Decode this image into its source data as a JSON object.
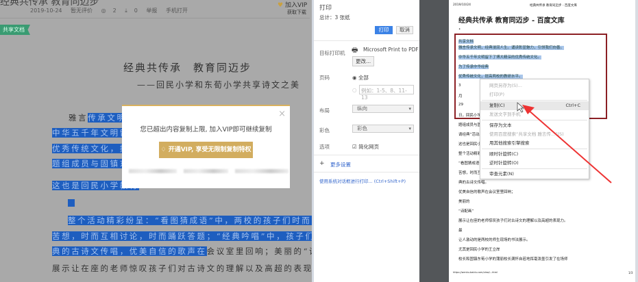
{
  "left_page": {
    "doc_title": "经典共传承 教育同迈步",
    "meta": {
      "date": "2019-10-24",
      "rating": "暂无评价",
      "views": "2",
      "downloads": "0",
      "report": "举报",
      "mobile": "手机打开"
    },
    "join_vip": "加入VIP",
    "join_vip_sub": "获取下载",
    "shared_tag": "共享文档",
    "title": "经典共传承　教育同迈步",
    "subtitle": "——回民小学和东荀小学共享诗文之美",
    "lines": [
      {
        "plain": "雅言",
        "hl": "传承文明，"
      },
      {
        "plain": "",
        "hl": "中华五千年文明留下"
      },
      {
        "plain": "",
        "hl": "优秀传统文化，提高"
      },
      {
        "plain": "",
        "hl": "题组成员与固镇东荀"
      },
      {
        "plain": "",
        "hl": "这也是回民小学教育"
      },
      {
        "plain": "",
        "hl": "整个活动精彩纷呈：“看图猜成语”中，两校的孩子们时而冥思"
      },
      {
        "plain": "",
        "hl": "苦想，时而互相讨论，时而踊跃答题；“经典吟唱”中，孩子们把经"
      },
      {
        "plain": "会议室里回响；美丽的“诗配画”",
        "hl": "典的古诗文传唱，优美自信的歌声在"
      },
      {
        "plain": "展示让在座的老师惊叹孩子们对古诗文的理解以及高超的表现力。最",
        "hl": ""
      }
    ],
    "modal": {
      "message": "您已超出内容复制上限, 加入VIP即可继续复制",
      "button": "开通VIP, 享受无限制复制特权",
      "close": "×"
    }
  },
  "print": {
    "title": "打印",
    "total": "总计：3 张纸",
    "print_btn": "打印",
    "cancel_btn": "取消",
    "printer_label": "目标打印机",
    "printer": "Microsoft Print to PDF",
    "change_btn": "更改...",
    "pages_label": "页码",
    "pages_all": "全部",
    "pages_placeholder": "例如：1-5、8、11-13",
    "layout_label": "布局",
    "layout_value": "纵向",
    "color_label": "彩色",
    "color_value": "彩色",
    "options_label": "选项",
    "simplify": "简化网页",
    "more": "更多设置",
    "system_dialog": "使用系统对话框进行打印... (Ctrl+Shift+P)"
  },
  "preview": {
    "header_date": "2019/10/24",
    "header_title": "经典共传承 教育同迈步 - 百度文库",
    "title": "经典共传承 教育同迈步 - 百度文库",
    "lines_hl": [
      "共享文档",
      "雅言传承文明，经典浸润人生。诵读彰显魅力，引领我们向善。",
      "中华五千年文明留下了博大精深的优秀传统文化。",
      "为了传承中华经典",
      "优秀传统文化，提高两校的教研水平。"
    ],
    "lines": [
      "3",
      "月",
      "29",
      "日，回民小学",
      "题组成员与固",
      "请经典”活动。",
      "这也是回民小学",
      "整个活动精彩",
      "“看图猜成语”",
      "苦想，时而互相",
      "典的古诗文传唱。",
      "优美自信的歌声在会议室里回响；",
      "美丽的",
      "“诗配画”",
      "展示让在座的老师惊叹孩子们对古诗文的理解以及高超的表现力。",
      "最",
      "让人激动的是两校的师生现场的书法展示。",
      "尤其是回民小学的王立岸",
      "校长和固镇东荀小学的蒲丽校长满怀自若地挥毫泼墨引发了在场师"
    ],
    "footer_url": "https://wenku.baidu.com/view/...html",
    "footer_page": "1/3"
  },
  "context_menu": [
    {
      "label": "网页另存为(S)...",
      "disabled": true
    },
    {
      "label": "打印(P)",
      "disabled": true
    },
    {
      "label": "复制(C)",
      "shortcut": "Ctrl+C",
      "hover": true
    },
    {
      "label": "发送文字到手机",
      "disabled": true
    },
    {
      "label": "保存为文本"
    },
    {
      "label": "使用百度搜索“共享文档 雅言传...”(S)",
      "disabled": true
    },
    {
      "label": "用其他搜索引擎搜索"
    },
    {
      "label": "顺时针旋转(C)"
    },
    {
      "label": "逆时针旋转(O)"
    },
    {
      "label": "审查元素(N)"
    }
  ]
}
